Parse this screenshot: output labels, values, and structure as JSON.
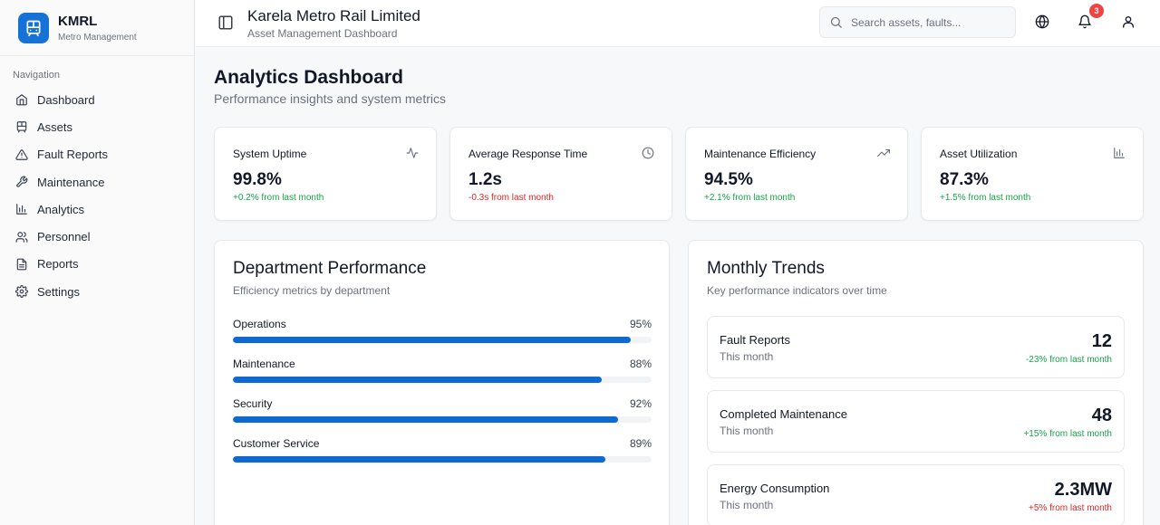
{
  "brand": {
    "name": "KMRL",
    "subtitle": "Metro Management"
  },
  "sidebar": {
    "heading": "Navigation",
    "items": [
      {
        "label": "Dashboard",
        "icon": "home-icon"
      },
      {
        "label": "Assets",
        "icon": "train-icon"
      },
      {
        "label": "Fault Reports",
        "icon": "alert-triangle-icon"
      },
      {
        "label": "Maintenance",
        "icon": "wrench-icon"
      },
      {
        "label": "Analytics",
        "icon": "bar-chart-icon"
      },
      {
        "label": "Personnel",
        "icon": "users-icon"
      },
      {
        "label": "Reports",
        "icon": "file-text-icon"
      },
      {
        "label": "Settings",
        "icon": "gear-icon"
      }
    ]
  },
  "header": {
    "title": "Karela Metro Rail Limited",
    "subtitle": "Asset Management Dashboard",
    "search_placeholder": "Search assets, faults...",
    "notification_count": "3"
  },
  "page": {
    "title": "Analytics Dashboard",
    "subtitle": "Performance insights and system metrics"
  },
  "kpis": [
    {
      "label": "System Uptime",
      "value": "99.8%",
      "change": "+0.2% from last month",
      "trend": "up",
      "icon": "activity-icon"
    },
    {
      "label": "Average Response Time",
      "value": "1.2s",
      "change": "-0.3s from last month",
      "trend": "down",
      "icon": "clock-icon"
    },
    {
      "label": "Maintenance Efficiency",
      "value": "94.5%",
      "change": "+2.1% from last month",
      "trend": "up",
      "icon": "trending-up-icon"
    },
    {
      "label": "Asset Utilization",
      "value": "87.3%",
      "change": "+1.5% from last month",
      "trend": "up",
      "icon": "bar-chart-icon"
    }
  ],
  "department": {
    "title": "Department Performance",
    "subtitle": "Efficiency metrics by department",
    "rows": [
      {
        "name": "Operations",
        "percent_label": "95%",
        "value": 95
      },
      {
        "name": "Maintenance",
        "percent_label": "88%",
        "value": 88
      },
      {
        "name": "Security",
        "percent_label": "92%",
        "value": 92
      },
      {
        "name": "Customer Service",
        "percent_label": "89%",
        "value": 89
      }
    ]
  },
  "trends": {
    "title": "Monthly Trends",
    "subtitle": "Key performance indicators over time",
    "items": [
      {
        "label": "Fault Reports",
        "period": "This month",
        "value": "12",
        "change": "-23% from last month",
        "tone": "positive"
      },
      {
        "label": "Completed Maintenance",
        "period": "This month",
        "value": "48",
        "change": "+15% from last month",
        "tone": "positive"
      },
      {
        "label": "Energy Consumption",
        "period": "This month",
        "value": "2.3MW",
        "change": "+5% from last month",
        "tone": "negative"
      }
    ]
  },
  "colors": {
    "accent": "#1672d6",
    "bar": "#0e6ad0",
    "positive": "#16a34a",
    "negative": "#dc2626",
    "badge": "#ef4444"
  }
}
